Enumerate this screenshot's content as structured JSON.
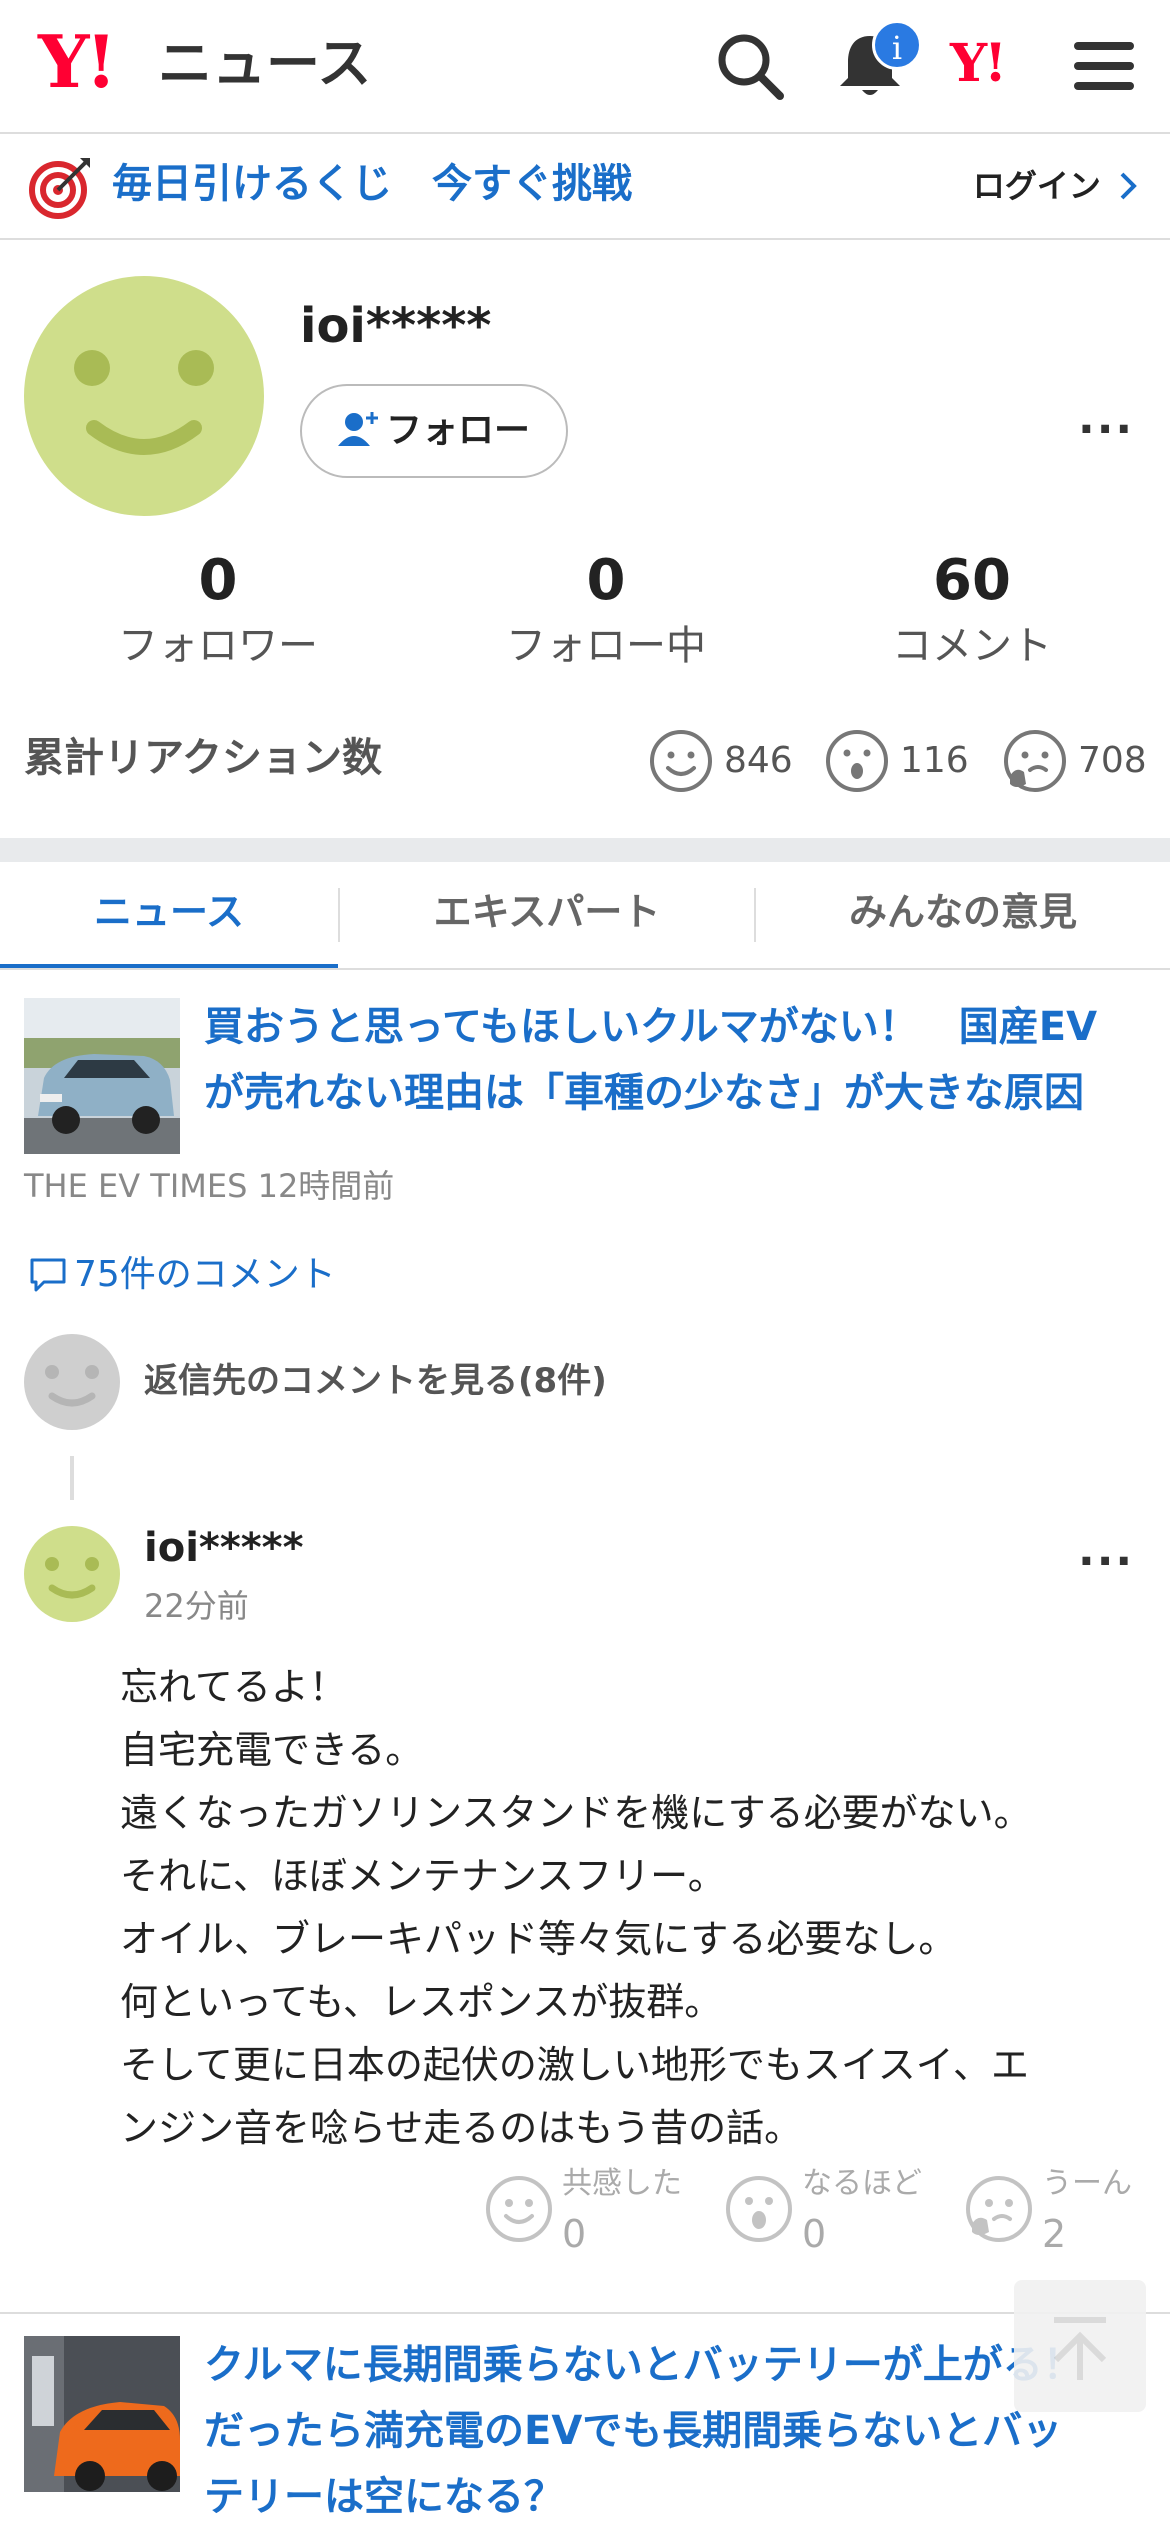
{
  "header": {
    "logo_y": "Y!",
    "logo_news": "ニュース",
    "notification_badge": "i",
    "yahoo_mark": "Y!"
  },
  "promo": {
    "text": "毎日引けるくじ　今すぐ挑戦",
    "login": "ログイン"
  },
  "profile": {
    "username": "ioi*****",
    "follow_label": "フォロー",
    "more": "···",
    "stats": [
      {
        "value": "0",
        "label": "フォロワー"
      },
      {
        "value": "0",
        "label": "フォロー中"
      },
      {
        "value": "60",
        "label": "コメント"
      }
    ],
    "reactions_title": "累計リアクション数",
    "reactions": [
      {
        "icon": "smile-face-icon",
        "count": "846"
      },
      {
        "icon": "surprised-face-icon",
        "count": "116"
      },
      {
        "icon": "thinking-face-icon",
        "count": "708"
      }
    ]
  },
  "tabs": [
    {
      "label": "ニュース",
      "active": true
    },
    {
      "label": "エキスパート",
      "active": false
    },
    {
      "label": "みんなの意見",
      "active": false
    }
  ],
  "article1": {
    "title": "買おうと思ってもほしいクルマがない！　国産EVが売れない理由は「車種の少なさ」が大きな原因",
    "title_lines": [
      "買おうと思ってもほしいクルマがない！　国産EV",
      "が売れない理由は「車種の少なさ」が大きな原因"
    ],
    "meta": "THE EV TIMES 12時間前",
    "comments_link": "75件のコメント"
  },
  "reply": {
    "link": "返信先のコメントを見る(8件)"
  },
  "comment": {
    "user": "ioi*****",
    "time": "22分前",
    "more": "···",
    "lines": [
      "忘れてるよ！",
      "自宅充電できる。",
      "遠くなったガソリンスタンドを機にする必要がない。",
      "それに、ほぼメンテナンスフリー。",
      "オイル、ブレーキパッド等々気にする必要なし。",
      "何といっても、レスポンスが抜群。",
      "そして更に日本の起伏の激しい地形でもスイスイ、エ",
      "ンジン音を唸らせ走るのはもう昔の話。"
    ],
    "reactions": [
      {
        "label": "共感した",
        "count": "0"
      },
      {
        "label": "なるほど",
        "count": "0"
      },
      {
        "label": "うーん",
        "count": "2"
      }
    ]
  },
  "article2": {
    "title_lines": [
      "クルマに長期間乗らないとバッテリーが上がる！",
      "だったら満充電のEVでも長期間乗らないとバッ",
      "テリーは空になる？"
    ]
  },
  "colors": {
    "brand_red": "#ff0033",
    "link_blue": "#1a6ec9",
    "avatar_green": "#cfde8b"
  }
}
